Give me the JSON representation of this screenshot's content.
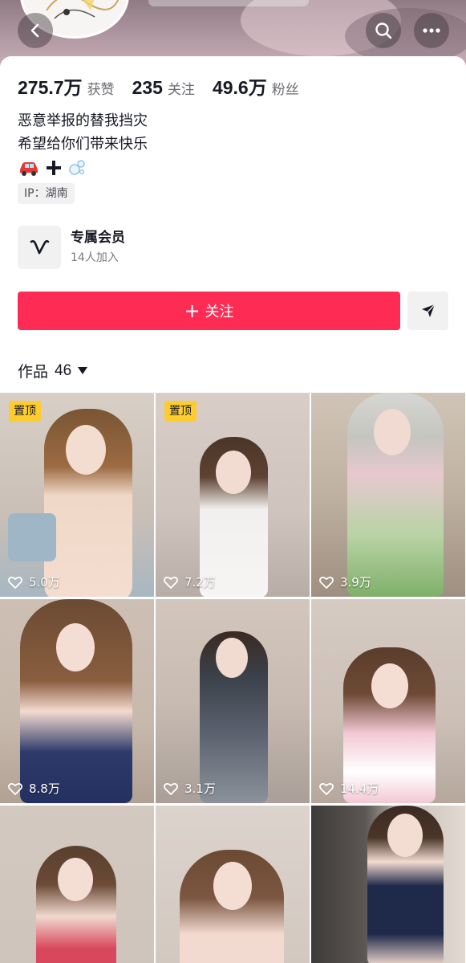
{
  "header": {
    "back_icon": "chevron-left-icon",
    "search_icon": "search-icon",
    "more_icon": "more-horizontal-icon"
  },
  "stats": [
    {
      "value": "275.7万",
      "label": "获赞"
    },
    {
      "value": "235",
      "label": "关注"
    },
    {
      "value": "49.6万",
      "label": "粉丝"
    }
  ],
  "bio": {
    "line1": "恶意举报的替我挡灾",
    "line2": "希望给你们带来快乐",
    "emojis": [
      "car-emoji",
      "plus-emoji",
      "bubbles-emoji"
    ]
  },
  "ip": "IP：湖南",
  "membership": {
    "title": "专属会员",
    "subtitle": "14人加入"
  },
  "actions": {
    "follow_label": "关注",
    "follow_color": "#fe2c55",
    "share_icon": "send-icon"
  },
  "works": {
    "label": "作品",
    "count": "46"
  },
  "pin_label": "置顶",
  "videos": [
    {
      "likes": "5.0万",
      "pinned": true
    },
    {
      "likes": "7.2万",
      "pinned": true
    },
    {
      "likes": "3.9万",
      "pinned": false
    },
    {
      "likes": "8.8万",
      "pinned": false
    },
    {
      "likes": "3.1万",
      "pinned": false
    },
    {
      "likes": "14.4万",
      "pinned": false
    },
    {
      "likes": "",
      "pinned": false
    },
    {
      "likes": "",
      "pinned": false
    },
    {
      "likes": "",
      "pinned": false
    }
  ]
}
